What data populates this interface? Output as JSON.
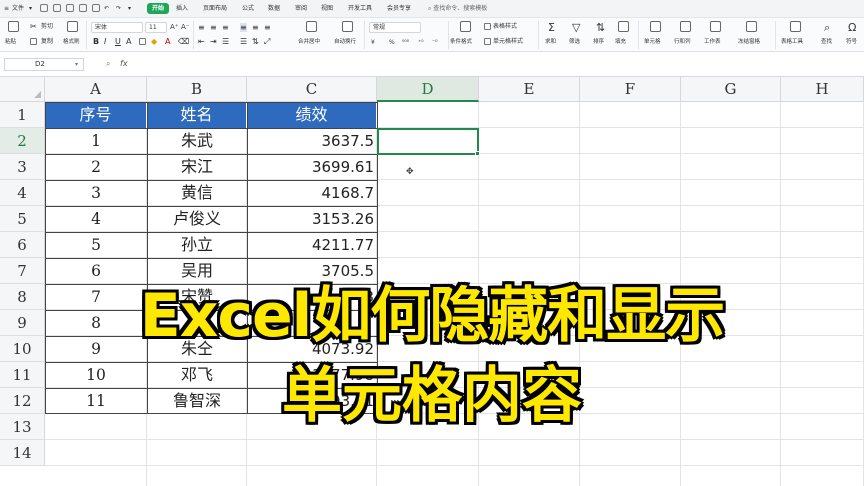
{
  "menubar": {
    "file_label": "文件",
    "tabs": [
      "开始",
      "插入",
      "页面布局",
      "公式",
      "数据",
      "审阅",
      "视图",
      "开发工具",
      "会员专享"
    ],
    "active_tab": "开始",
    "search_placeholder": "查找命令、搜索模板"
  },
  "ribbon": {
    "cut_label": "剪切",
    "copy_label": "复制",
    "paste_label": "粘贴",
    "format_painter_label": "格式刷",
    "font_name": "宋体",
    "font_size": "11",
    "bold": "B",
    "italic": "I",
    "underline": "U",
    "merge_label": "合并居中",
    "wrap_label": "自动换行",
    "number_format": "常规",
    "currency_symbol": "¥",
    "percent_symbol": "%",
    "table_style_label": "表格样式",
    "cond_format_label": "条件格式",
    "cell_style_label": "单元格样式",
    "sum_label": "求和",
    "filter_label": "筛选",
    "sort_label": "排序",
    "fill_label": "填充",
    "cell_label": "单元格",
    "rowcol_label": "行和列",
    "worksheet_label": "工作表",
    "freeze_label": "冻结窗格",
    "table_tools_label": "表格工具",
    "find_label": "查找",
    "symbol_label": "符号"
  },
  "formula_bar": {
    "name_box": "D2",
    "fx": "fx",
    "value": ""
  },
  "sheet": {
    "columns": [
      "A",
      "B",
      "C",
      "D",
      "E",
      "F",
      "G",
      "H"
    ],
    "rows": [
      "1",
      "2",
      "3",
      "4",
      "5",
      "6",
      "7",
      "8",
      "9",
      "10",
      "11",
      "12",
      "13",
      "14"
    ],
    "selected_column": "D",
    "selected_row": "2",
    "header_row": [
      "序号",
      "姓名",
      "绩效"
    ],
    "data": [
      [
        "1",
        "朱武",
        "3637.5"
      ],
      [
        "2",
        "宋江",
        "3699.61"
      ],
      [
        "3",
        "黄信",
        "4168.7"
      ],
      [
        "4",
        "卢俊义",
        "3153.26"
      ],
      [
        "5",
        "孙立",
        "4211.77"
      ],
      [
        "6",
        "吴用",
        "3705.5"
      ],
      [
        "7",
        "宋赞",
        "3"
      ],
      [
        "8",
        "",
        ""
      ],
      [
        "9",
        "朱仝",
        "4073.92"
      ],
      [
        "10",
        "邓飞",
        "3577.98"
      ],
      [
        "11",
        "鲁智深",
        "4093.81"
      ]
    ],
    "header_color": "#2e6bbe",
    "accent_color": "#1f8a4c"
  },
  "overlay": {
    "line1": "Excel如何隐藏和显示",
    "line2": "单元格内容",
    "color": "#ffe800"
  }
}
